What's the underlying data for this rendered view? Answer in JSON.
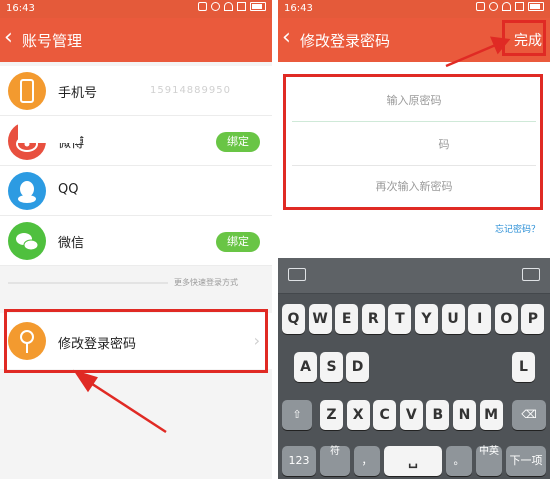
{
  "left_screen": {
    "status_time": "16:43",
    "title": "账号管理",
    "accounts": [
      {
        "label": "手机号",
        "value": "15914889950",
        "action": "",
        "icon": "phone-icon"
      },
      {
        "label": "微博",
        "value": "",
        "action": "绑定",
        "icon": "weibo-icon"
      },
      {
        "label": "QQ",
        "value": "",
        "action": "",
        "icon": "qq-icon"
      },
      {
        "label": "微信",
        "value": "",
        "action": "绑定",
        "icon": "wechat-icon"
      }
    ],
    "quick_login_text": "更多快速登录方式",
    "change_password_label": "修改登录密码"
  },
  "right_screen": {
    "status_time": "16:43",
    "title": "修改登录密码",
    "done_label": "完成",
    "fields": {
      "old_password_placeholder": "输入原密码",
      "new_password_placeholder": "码",
      "confirm_password_placeholder": "再次输入新密码"
    },
    "forgot_password": "忘记密码？"
  },
  "keyboard": {
    "row1": [
      "Q",
      "W",
      "E",
      "R",
      "T",
      "Y",
      "U",
      "I",
      "O",
      "P"
    ],
    "row2": [
      "A",
      "S",
      "D",
      "L"
    ],
    "row3": [
      "Z",
      "X",
      "C",
      "V",
      "B",
      "N",
      "M"
    ],
    "bottom": {
      "num": "123",
      "symbol": "符",
      "comma": "，",
      "period": "。",
      "lang_top": "中",
      "lang_bottom": "英",
      "next": "下一项"
    }
  },
  "colors": {
    "titlebar": "#ea5a3c",
    "bind_button": "#69c545",
    "highlight_box": "#e02a24",
    "link": "#2b8fd6"
  }
}
